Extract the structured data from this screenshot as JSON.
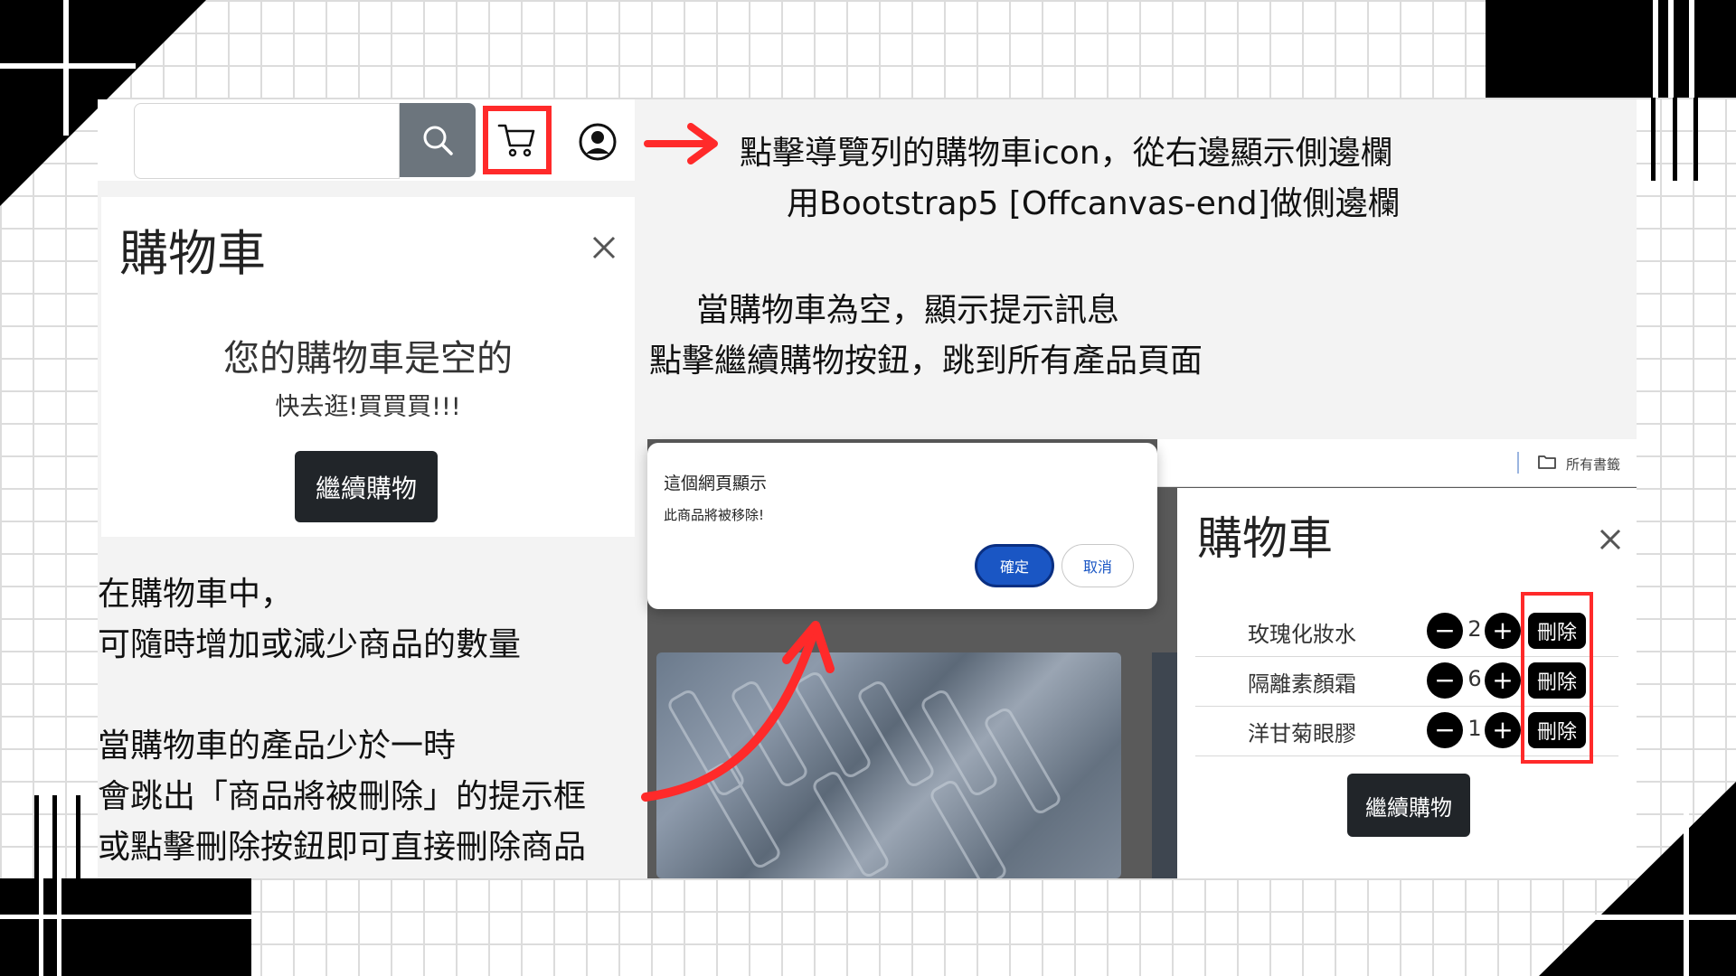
{
  "navbar": {
    "search_placeholder": "",
    "search_icon": "search-icon",
    "cart_icon": "cart-icon",
    "user_icon": "user-circle-icon"
  },
  "annotations": {
    "nav_line1": "點擊導覽列的購物車icon，從右邊顯示側邊欄",
    "nav_line2": "用Bootstrap5 [Offcanvas-end]做側邊欄",
    "empty_line1": "當購物車為空，顯示提示訊息",
    "empty_line2": "點擊繼續購物按鈕，跳到所有產品頁面",
    "qty_line1": "在購物車中，",
    "qty_line2": "可隨時增加或減少商品的數量",
    "remove_line1": "當購物車的產品少於一時",
    "remove_line2": "會跳出「商品將被刪除」的提示框",
    "remove_line3": "或點擊刪除按鈕即可直接刪除商品"
  },
  "empty_cart": {
    "title": "購物車",
    "message": "您的購物車是空的",
    "sub_message": "快去逛!買買買!!!",
    "continue_label": "繼續購物"
  },
  "dialog": {
    "title": "這個網頁顯示",
    "message": "此商品將被移除!",
    "ok_label": "確定",
    "cancel_label": "取消"
  },
  "browser_bar": {
    "bookmarks_label": "所有書籤"
  },
  "cart": {
    "title": "購物車",
    "items": [
      {
        "name": "玫瑰化妝水",
        "qty": "2",
        "delete_label": "刪除"
      },
      {
        "name": "隔離素顏霜",
        "qty": "6",
        "delete_label": "刪除"
      },
      {
        "name": "洋甘菊眼膠",
        "qty": "1",
        "delete_label": "刪除"
      }
    ],
    "continue_label": "繼續購物"
  },
  "colors": {
    "highlight": "#ff2a2a",
    "dark_button": "#212529",
    "search_button": "#6c757d",
    "dialog_primary": "#1a56c4"
  }
}
